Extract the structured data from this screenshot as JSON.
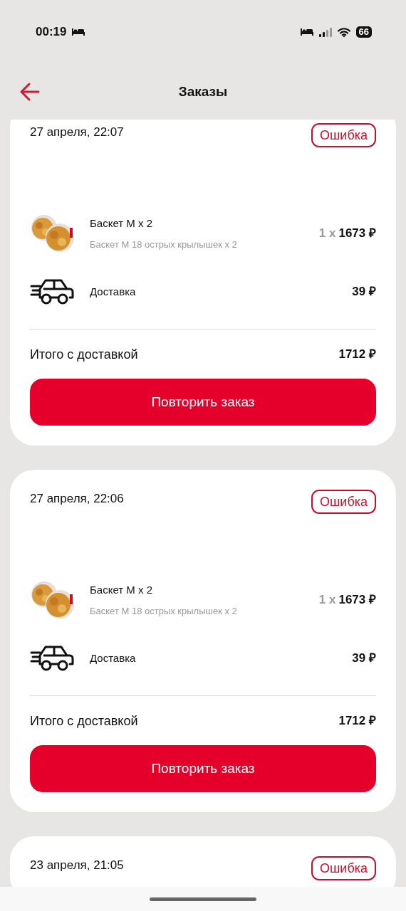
{
  "status_bar": {
    "time": "00:19",
    "battery": "66"
  },
  "header": {
    "title": "Заказы"
  },
  "orders": [
    {
      "date": "27 апреля, 22:07",
      "status": {
        "label": "Ошибка",
        "kind": "error"
      },
      "items": [
        {
          "kind": "product",
          "name": "Баскет М x 2",
          "description": "Баскет М 18 острых крылышек x 2",
          "quantity": "1 x",
          "price": "1673 ₽"
        },
        {
          "kind": "delivery",
          "name": "Доставка",
          "price": "39 ₽"
        }
      ],
      "total_label": "Итого с доставкой",
      "total": "1712 ₽",
      "button": "Повторить заказ"
    },
    {
      "date": "27 апреля, 22:06",
      "status": {
        "label": "Ошибка",
        "kind": "error"
      },
      "items": [
        {
          "kind": "product",
          "name": "Баскет М x 2",
          "description": "Баскет М 18 острых крылышек x 2",
          "quantity": "1 x",
          "price": "1673 ₽"
        },
        {
          "kind": "delivery",
          "name": "Доставка",
          "price": "39 ₽"
        }
      ],
      "total_label": "Итого с доставкой",
      "total": "1712 ₽",
      "button": "Повторить заказ"
    },
    {
      "date": "23 апреля, 21:05",
      "status": {
        "label": "Ошибка",
        "kind": "error"
      }
    }
  ]
}
